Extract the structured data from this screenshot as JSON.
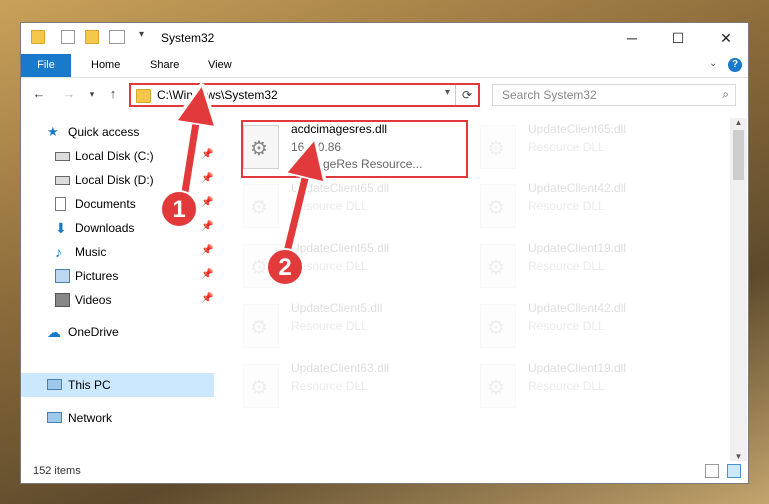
{
  "window": {
    "title": "System32"
  },
  "ribbon": {
    "tabs": [
      "File",
      "Home",
      "Share",
      "View"
    ]
  },
  "address": {
    "path": "C:\\Windows\\System32"
  },
  "search": {
    "placeholder": "Search System32"
  },
  "sidebar": {
    "items": [
      {
        "label": "Quick access",
        "icon": "star-icon"
      },
      {
        "label": "Local Disk (C:)",
        "icon": "drive-icon"
      },
      {
        "label": "Local Disk (D:)",
        "icon": "drive-icon"
      },
      {
        "label": "Documents",
        "icon": "document-icon"
      },
      {
        "label": "Downloads",
        "icon": "download-icon"
      },
      {
        "label": "Music",
        "icon": "music-icon"
      },
      {
        "label": "Pictures",
        "icon": "picture-icon"
      },
      {
        "label": "Videos",
        "icon": "video-icon"
      },
      {
        "label": "OneDrive",
        "icon": "cloud-icon"
      },
      {
        "label": "This PC",
        "icon": "computer-icon"
      },
      {
        "label": "Network",
        "icon": "network-icon"
      }
    ]
  },
  "files": {
    "highlighted": {
      "name": "acdcimagesres.dll",
      "version": "16.0.0.86",
      "description": "dcimageRes Resource..."
    },
    "faded": [
      {
        "name": "UpdateClient65.dll",
        "desc": "Resource DLL"
      },
      {
        "name": "UpdateClient65.dll",
        "desc": "Resource DLL"
      },
      {
        "name": "UpdateClient42.dll",
        "desc": "Resource DLL"
      },
      {
        "name": "UpdateClient65.dll",
        "desc": "Resource DLL"
      },
      {
        "name": "UpdateClient19.dll",
        "desc": "Resource DLL"
      },
      {
        "name": "UpdateClient5.dll",
        "desc": "Resource DLL"
      },
      {
        "name": "UpdateClient42.dll",
        "desc": "Resource DLL"
      },
      {
        "name": "UpdateClient63.dll",
        "desc": "Resource DLL"
      },
      {
        "name": "UpdateClient19.dll",
        "desc": "Resource DLL"
      }
    ]
  },
  "status": {
    "count": "152 items"
  },
  "callouts": [
    "1",
    "2"
  ],
  "colors": {
    "accent": "#1979ca",
    "callout": "#e23a3a",
    "selection": "#cce8ff"
  }
}
